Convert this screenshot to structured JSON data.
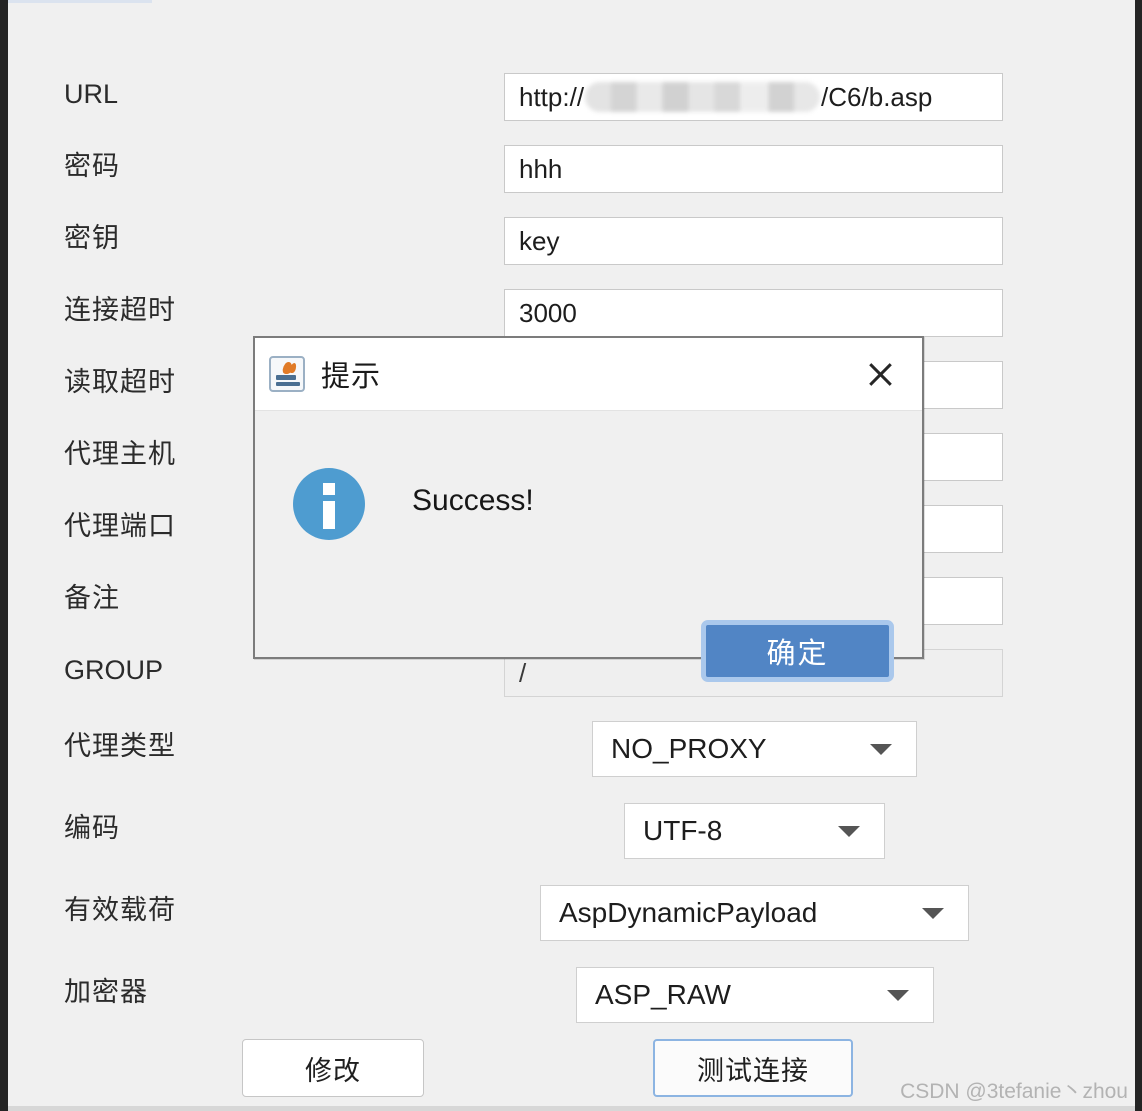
{
  "window": {
    "background_color": "#f0f0f0",
    "edge_color": "#242424"
  },
  "form": {
    "fields": [
      {
        "label": "URL",
        "type": "text",
        "value_prefix": "http://",
        "value_suffix": "/C6/b.asp",
        "redacted": true,
        "value": "http://            /C6/b.asp"
      },
      {
        "label": "密码",
        "type": "text",
        "value": "hhh"
      },
      {
        "label": "密钥",
        "type": "text",
        "value": "key"
      },
      {
        "label": "连接超时",
        "type": "text",
        "value": "3000"
      },
      {
        "label": "读取超时",
        "type": "text",
        "value": ""
      },
      {
        "label": "代理主机",
        "type": "text",
        "value": ""
      },
      {
        "label": "代理端口",
        "type": "text",
        "value": ""
      },
      {
        "label": "备注",
        "type": "text",
        "value": ""
      },
      {
        "label": "GROUP",
        "type": "text",
        "value": "/",
        "disabled": true
      },
      {
        "label": "代理类型",
        "type": "combo",
        "value": "NO_PROXY"
      },
      {
        "label": "编码",
        "type": "combo",
        "value": "UTF-8"
      },
      {
        "label": "有效载荷",
        "type": "combo",
        "value": "AspDynamicPayload"
      },
      {
        "label": "加密器",
        "type": "combo",
        "value": "ASP_RAW"
      }
    ]
  },
  "actions": {
    "modify_label": "修改",
    "test_connection_label": "测试连接"
  },
  "dialog": {
    "title": "提示",
    "title_icon": "java-coffee-cup-icon",
    "close_icon": "close-icon",
    "severity_icon": "info-icon",
    "severity_color": "#4e9cd0",
    "message": "Success!",
    "ok_label": "确定",
    "ok_color": "#5185c5",
    "ok_focus_ring": "#aac8ec"
  },
  "watermark": {
    "text": "CSDN @3tefanie丶zhou"
  }
}
